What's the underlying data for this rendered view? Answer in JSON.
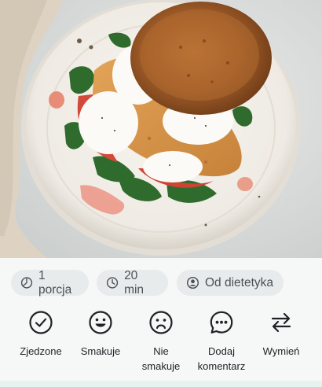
{
  "meta": {
    "portion": "1 porcja",
    "time": "20 min",
    "source": "Od dietetyka"
  },
  "icons": {
    "portion": "pie-chart-icon",
    "time": "clock-icon",
    "source": "user-circle-icon"
  },
  "actions": [
    {
      "label": "Zjedzone",
      "icon": "check-circle-icon"
    },
    {
      "label": "Smakuje",
      "icon": "smile-icon"
    },
    {
      "label": "Nie smakuje",
      "icon": "sad-face-icon"
    },
    {
      "label": "Dodaj komentarz",
      "icon": "comment-icon"
    },
    {
      "label": "Wymień",
      "icon": "swap-arrows-icon"
    }
  ],
  "colors": {
    "chip_bg": "#e8ebec",
    "chip_text": "#4a5054",
    "icon_dark": "#1f2326",
    "page_bg": "#f6f7f7"
  }
}
